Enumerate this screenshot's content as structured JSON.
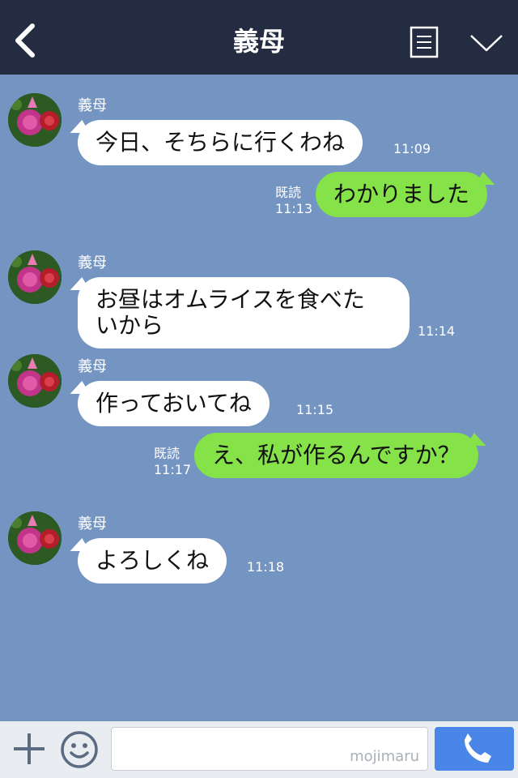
{
  "header": {
    "title": "義母",
    "back_icon": "chevron-left-icon",
    "menu_icon": "menu-icon",
    "dropdown_icon": "chevron-down-icon"
  },
  "colors": {
    "header_bg": "#242c42",
    "chat_bg": "#7494c1",
    "incoming_bubble": "#ffffff",
    "outgoing_bubble": "#85e249",
    "call_button": "#4a86e8"
  },
  "messages": [
    {
      "sender": "義母",
      "text": "今日、そちらに行くわね",
      "time": "11:09"
    },
    {
      "text": "わかりました",
      "read": "既読",
      "time": "11:13"
    },
    {
      "sender": "義母",
      "text": "お昼はオムライスを食べたいから",
      "line1": "お昼はオムライスを食べた",
      "line2": "いから",
      "time": "11:14"
    },
    {
      "sender": "義母",
      "text": "作っておいてね",
      "time": "11:15"
    },
    {
      "text": "え、私が作るんですか？",
      "read": "既読",
      "time": "11:17"
    },
    {
      "sender": "義母",
      "text": "よろしくね",
      "time": "11:18"
    }
  ],
  "footer": {
    "plus_icon": "plus-icon",
    "emoji_icon": "smiley-icon",
    "input_placeholder": "",
    "watermark": "mojimaru",
    "call_icon": "phone-icon"
  }
}
